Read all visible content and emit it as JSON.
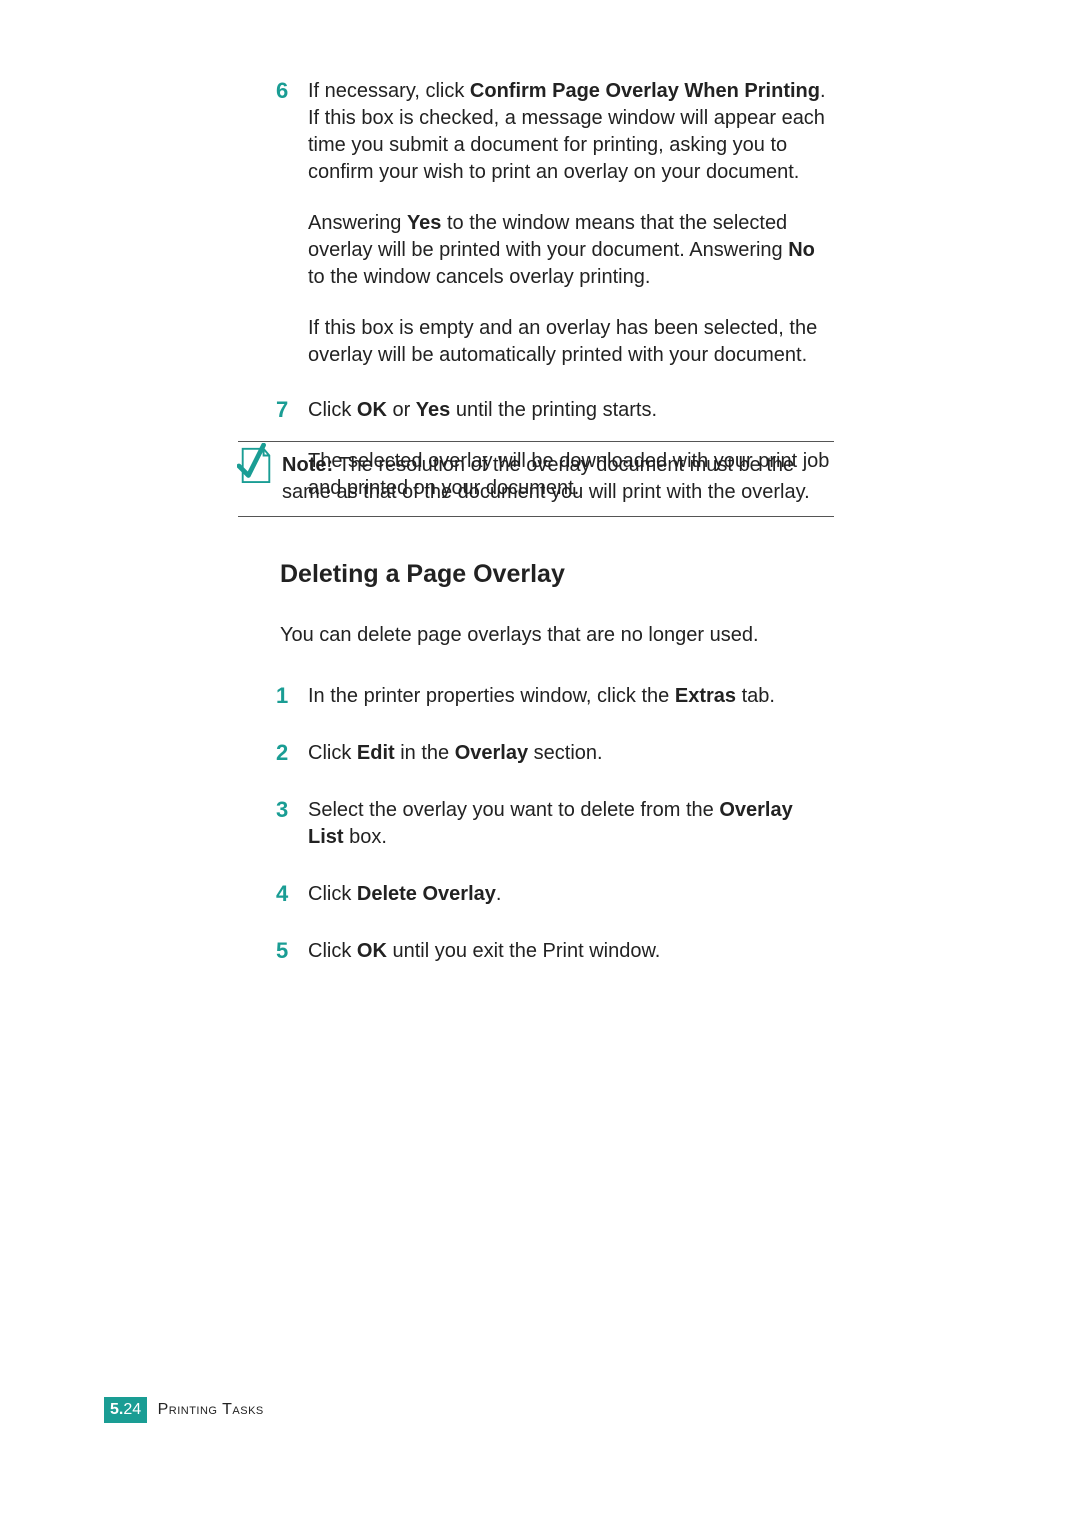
{
  "stepsA": {
    "s6": {
      "num": "6",
      "p1_a": "If necessary, click ",
      "p1_b": "Confirm Page Overlay When Printing",
      "p1_c": ". If this box is checked, a message window will appear each time you submit a document for printing, asking you to confirm your wish to print an overlay on your document.",
      "p2_a": "Answering ",
      "p2_b": "Yes",
      "p2_c": " to the window means that the selected overlay will be printed with your document. Answering ",
      "p2_d": "No",
      "p2_e": " to the window cancels overlay printing.",
      "p3": "If this box is empty and an overlay has been selected, the overlay will be automatically printed with your document."
    },
    "s7": {
      "num": "7",
      "p1_a": "Click ",
      "p1_b": "OK",
      "p1_c": " or ",
      "p1_d": "Yes",
      "p1_e": " until the printing starts.",
      "p2": "The selected overlay will be downloaded with your print job and printed on your document."
    }
  },
  "note": {
    "label": "Note:",
    "text": " The resolution of the overlay document must be the same as that of the document you will print with the overlay."
  },
  "section": {
    "heading": "Deleting a Page Overlay",
    "intro": "You can delete page overlays that are no longer used."
  },
  "stepsB": {
    "s1": {
      "num": "1",
      "a": "In the printer properties window, click the ",
      "b": "Extras",
      "c": " tab."
    },
    "s2": {
      "num": "2",
      "a": "Click ",
      "b": "Edit",
      "c": " in the ",
      "d": "Overlay",
      "e": " section."
    },
    "s3": {
      "num": "3",
      "a": "Select the overlay you want to delete from the ",
      "b": "Overlay List",
      "c": " box."
    },
    "s4": {
      "num": "4",
      "a": "Click ",
      "b": "Delete Overlay",
      "c": "."
    },
    "s5": {
      "num": "5",
      "a": "Click ",
      "b": "OK",
      "c": " until you exit the Print window."
    }
  },
  "footer": {
    "chapter": "5.",
    "page": "24",
    "title": "Printing Tasks"
  }
}
